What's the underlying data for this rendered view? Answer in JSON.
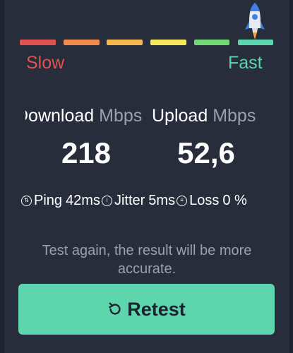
{
  "speed_scale": {
    "segment_colors": [
      "#e05252",
      "#ef8b4c",
      "#f5b84f",
      "#f5e85a",
      "#74d775",
      "#5ed6ad"
    ],
    "slow_label": "Slow",
    "fast_label": "Fast",
    "slow_color": "#e05252",
    "fast_color": "#5ed6ad",
    "indicator_icon": "rocket-icon"
  },
  "download": {
    "title": "Download",
    "unit": "Mbps",
    "value": "218"
  },
  "upload": {
    "title": "Upload",
    "unit": "Mbps",
    "value": "52,6"
  },
  "stats": {
    "ping": {
      "label": "Ping",
      "value": "42ms",
      "icon": "ping-icon"
    },
    "jitter": {
      "label": "Jitter",
      "value": "5ms",
      "icon": "jitter-icon"
    },
    "loss": {
      "label": "Loss",
      "value": "0 %",
      "icon": "loss-icon"
    }
  },
  "hint_text": "Test again, the result will be more accurate.",
  "retest_button": {
    "label": "Retest",
    "icon": "refresh-icon",
    "color": "#5ed6ad"
  }
}
